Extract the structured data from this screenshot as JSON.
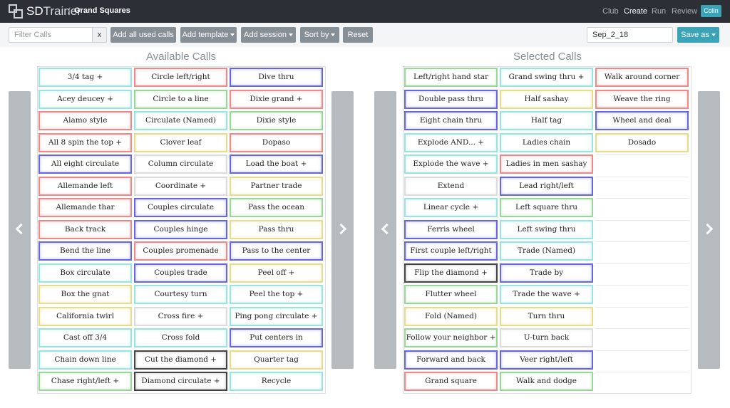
{
  "navbar": {
    "brand_sd": "SD",
    "brand_trainer": "Trainer",
    "separator": "/",
    "breadcrumb": "Grand Squares",
    "links": [
      "Club",
      "Create",
      "Run",
      "Review"
    ],
    "active_link": "Create",
    "user": "Colin"
  },
  "toolbar": {
    "filter_placeholder": "Filter Calls",
    "filter_clear": "x",
    "add_all_used": "Add all used calls",
    "add_template": "Add template",
    "add_session": "Add session",
    "sort_by": "Sort by",
    "reset": "Reset",
    "session_name": "Sep_2_18",
    "save_as": "Save as"
  },
  "available": {
    "title": "Available Calls",
    "calls": [
      {
        "label": "3/4 tag +",
        "color": "cyan"
      },
      {
        "label": "Circle left/right",
        "color": "red"
      },
      {
        "label": "Dive thru",
        "color": "blue"
      },
      {
        "label": "Acey deucey +",
        "color": "cyan"
      },
      {
        "label": "Circle to a line",
        "color": "green"
      },
      {
        "label": "Dixie grand +",
        "color": "red"
      },
      {
        "label": "Alamo style",
        "color": "red"
      },
      {
        "label": "Circulate (Named)",
        "color": "cyan"
      },
      {
        "label": "Dixie style",
        "color": "green"
      },
      {
        "label": "All 8 spin the top +",
        "color": "red"
      },
      {
        "label": "Clover leaf",
        "color": "yellow"
      },
      {
        "label": "Dopaso",
        "color": "red"
      },
      {
        "label": "All eight circulate",
        "color": "blue"
      },
      {
        "label": "Column circulate",
        "color": "gray"
      },
      {
        "label": "Load the boat +",
        "color": "blue"
      },
      {
        "label": "Allemande left",
        "color": "red"
      },
      {
        "label": "Coordinate +",
        "color": "gray"
      },
      {
        "label": "Partner trade",
        "color": "yellow"
      },
      {
        "label": "Allemande thar",
        "color": "red"
      },
      {
        "label": "Couples circulate",
        "color": "blue"
      },
      {
        "label": "Pass the ocean",
        "color": "green"
      },
      {
        "label": "Back track",
        "color": "red"
      },
      {
        "label": "Couples hinge",
        "color": "blue"
      },
      {
        "label": "Pass thru",
        "color": "yellow"
      },
      {
        "label": "Bend the line",
        "color": "blue"
      },
      {
        "label": "Couples promenade",
        "color": "red"
      },
      {
        "label": "Pass to the center",
        "color": "blue"
      },
      {
        "label": "Box circulate",
        "color": "cyan"
      },
      {
        "label": "Couples trade",
        "color": "blue"
      },
      {
        "label": "Peel off +",
        "color": "yellow"
      },
      {
        "label": "Box the gnat",
        "color": "yellow"
      },
      {
        "label": "Courtesy turn",
        "color": "cyan"
      },
      {
        "label": "Peel the top +",
        "color": "cyan"
      },
      {
        "label": "California twirl",
        "color": "yellow"
      },
      {
        "label": "Cross fire +",
        "color": "gray"
      },
      {
        "label": "Ping pong circulate +",
        "color": "cyan"
      },
      {
        "label": "Cast off 3/4",
        "color": "cyan"
      },
      {
        "label": "Cross fold",
        "color": "cyan"
      },
      {
        "label": "Put centers in",
        "color": "blue"
      },
      {
        "label": "Chain down line",
        "color": "cyan"
      },
      {
        "label": "Cut the diamond +",
        "color": "black"
      },
      {
        "label": "Quarter tag",
        "color": "yellow"
      },
      {
        "label": "Chase right/left +",
        "color": "green"
      },
      {
        "label": "Diamond circulate +",
        "color": "black"
      },
      {
        "label": "Recycle",
        "color": "cyan"
      }
    ]
  },
  "selected": {
    "title": "Selected Calls",
    "calls": [
      {
        "label": "Left/right hand star",
        "color": "green"
      },
      {
        "label": "Grand swing thru +",
        "color": "cyan"
      },
      {
        "label": "Walk around corner",
        "color": "red"
      },
      {
        "label": "Double pass thru",
        "color": "blue"
      },
      {
        "label": "Half sashay",
        "color": "yellow"
      },
      {
        "label": "Weave the ring",
        "color": "red"
      },
      {
        "label": "Eight chain thru",
        "color": "blue"
      },
      {
        "label": "Half tag",
        "color": "cyan"
      },
      {
        "label": "Wheel and deal",
        "color": "blue"
      },
      {
        "label": "Explode AND... +",
        "color": "cyan"
      },
      {
        "label": "Ladies chain",
        "color": "cyan"
      },
      {
        "label": "Dosado",
        "color": "yellow"
      },
      {
        "label": "Explode the wave +",
        "color": "cyan"
      },
      {
        "label": "Ladies in men sashay",
        "color": "red"
      },
      {
        "label": "",
        "color": "empty"
      },
      {
        "label": "Extend",
        "color": "gray"
      },
      {
        "label": "Lead right/left",
        "color": "blue"
      },
      {
        "label": "",
        "color": "empty"
      },
      {
        "label": "Linear cycle +",
        "color": "cyan"
      },
      {
        "label": "Left square thru",
        "color": "green"
      },
      {
        "label": "",
        "color": "empty"
      },
      {
        "label": "Ferris wheel",
        "color": "blue"
      },
      {
        "label": "Left swing thru",
        "color": "cyan"
      },
      {
        "label": "",
        "color": "empty"
      },
      {
        "label": "First couple left/right",
        "color": "blue"
      },
      {
        "label": "Trade (Named)",
        "color": "cyan"
      },
      {
        "label": "",
        "color": "empty"
      },
      {
        "label": "Flip the diamond +",
        "color": "black"
      },
      {
        "label": "Trade by",
        "color": "blue"
      },
      {
        "label": "",
        "color": "empty"
      },
      {
        "label": "Flutter wheel",
        "color": "green"
      },
      {
        "label": "Trade the wave +",
        "color": "cyan"
      },
      {
        "label": "",
        "color": "empty"
      },
      {
        "label": "Fold (Named)",
        "color": "yellow"
      },
      {
        "label": "Turn thru",
        "color": "yellow"
      },
      {
        "label": "",
        "color": "empty"
      },
      {
        "label": "Follow your neighbor +",
        "color": "green"
      },
      {
        "label": "U-turn back",
        "color": "gray"
      },
      {
        "label": "",
        "color": "empty"
      },
      {
        "label": "Forward and back",
        "color": "blue"
      },
      {
        "label": "Veer right/left",
        "color": "blue"
      },
      {
        "label": "",
        "color": "empty"
      },
      {
        "label": "Grand square",
        "color": "red"
      },
      {
        "label": "Walk and dodge",
        "color": "green"
      },
      {
        "label": "",
        "color": "empty"
      }
    ]
  },
  "icons": {
    "prev_available": "chevron-left-icon",
    "next_available": "chevron-right-icon",
    "prev_selected": "chevron-left-icon",
    "next_selected": "chevron-right-icon"
  }
}
